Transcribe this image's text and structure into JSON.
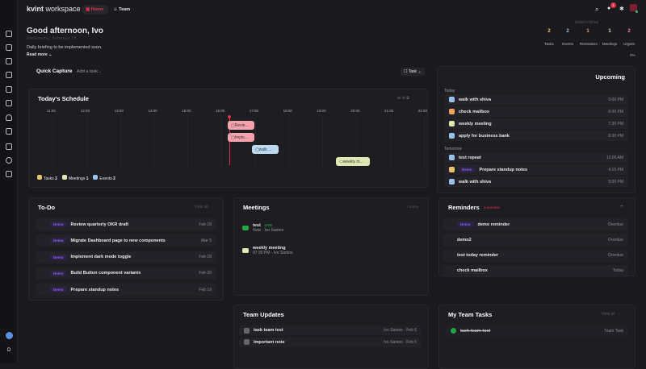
{
  "header": {
    "logo_bold": "kvint",
    "logo_rest": " workspace",
    "tabs": [
      {
        "label": "Home"
      },
      {
        "label": "Team"
      }
    ],
    "notif_count": "1"
  },
  "greeting": {
    "title": "Good afternoon, Ivo",
    "date": "Wednesday, February 18",
    "briefing": "Daily briefing to be implemented soon.",
    "read_more": "Read more"
  },
  "focus": {
    "label": "today's focus",
    "items": [
      {
        "value": "2",
        "label": "Tasks",
        "color": "#e7c46b"
      },
      {
        "value": "2",
        "label": "Events",
        "color": "#9cc3e6"
      },
      {
        "value": "1",
        "label": "Reminders",
        "color": "#e7a46b"
      },
      {
        "value": "1",
        "label": "Meetings",
        "color": "#d9e3a8"
      },
      {
        "value": "2",
        "label": "Urgent",
        "color": "#f08a9a"
      }
    ],
    "progress": "0%"
  },
  "quick_capture": {
    "title": "Quick Capture",
    "placeholder": "Add a task...",
    "type": "Task"
  },
  "schedule": {
    "title": "Today's Schedule",
    "hours": [
      "11:00",
      "12:00",
      "13:00",
      "14:00",
      "15:00",
      "16:00",
      "17:00",
      "18:00",
      "19:00",
      "20:00",
      "21:00",
      "22:00"
    ],
    "events": [
      {
        "label": "Revie...",
        "color": "#f4a3ae"
      },
      {
        "label": "Imple...",
        "color": "#f4a3ae"
      },
      {
        "label": "walk ...",
        "color": "#bcd9f0"
      },
      {
        "label": "weekly m...",
        "color": "#dfe8b5"
      }
    ],
    "legend": [
      {
        "label": "Tasks",
        "count": "2"
      },
      {
        "label": "Meetings",
        "count": "1"
      },
      {
        "label": "Events",
        "count": "2"
      }
    ]
  },
  "upcoming": {
    "title": "Upcoming",
    "groups": [
      {
        "label": "Today",
        "items": [
          {
            "title": "walk with shiva",
            "time": "5:00 PM",
            "color": "#9cc3e6"
          },
          {
            "title": "check mailbox",
            "time": "6:00 PM",
            "color": "#f0a35c"
          },
          {
            "title": "weekly meeting",
            "time": "7:30 PM",
            "color": "#dfe8b5"
          },
          {
            "title": "apply for business bank",
            "time": "6:00 PM",
            "color": "#9cc3e6"
          }
        ]
      },
      {
        "label": "Tomorrow",
        "items": [
          {
            "title": "test repeat",
            "time": "12:00 AM",
            "color": "#9cc3e6"
          },
          {
            "tag": "Demo",
            "title": "Prepare standup notes",
            "time": "4:15 PM",
            "color": "#e7c46b"
          },
          {
            "title": "walk with shiva",
            "time": "5:00 PM",
            "color": "#9cc3e6"
          }
        ]
      }
    ]
  },
  "todo": {
    "title": "To-Do",
    "view_all": "View all →",
    "items": [
      {
        "tag": "Demo",
        "title": "Review quarterly OKR draft",
        "date": "Feb 18"
      },
      {
        "tag": "Demo",
        "title": "Migrate Dashboard page to new components",
        "date": "Mar 5"
      },
      {
        "tag": "Demo",
        "title": "Implement dark mode toggle",
        "date": "Feb 18"
      },
      {
        "tag": "Demo",
        "title": "Build Button component variants",
        "date": "Feb 20"
      },
      {
        "tag": "Demo",
        "title": "Prepare standup notes",
        "date": "Feb 19"
      }
    ]
  },
  "meetings": {
    "title": "Meetings",
    "count": "2 today",
    "items": [
      {
        "title": "test",
        "badge": "LIVE",
        "sub": "Now · Ivo Santos",
        "color": "#22a447"
      },
      {
        "title": "weekly meeting",
        "sub": "07:30 PM · Ivo Santos",
        "color": "#dfe8b5"
      }
    ]
  },
  "reminders": {
    "title": "Reminders",
    "overdue": "3 overdue",
    "add": "+",
    "items": [
      {
        "tag": "Demo",
        "title": "demo reminder",
        "status": "Overdue"
      },
      {
        "title": "demo2",
        "status": "Overdue"
      },
      {
        "title": "test today reminder",
        "status": "Overdue"
      },
      {
        "title": "check mailbox",
        "status": "Today"
      }
    ]
  },
  "team_updates": {
    "title": "Team Updates",
    "items": [
      {
        "title": "task team test",
        "meta": "Ivo Santos · Feb 6"
      },
      {
        "title": "important note",
        "meta": "Ivo Santos · Feb 6"
      }
    ]
  },
  "team_tasks": {
    "title": "My Team Tasks",
    "view_all": "View all →",
    "items": [
      {
        "title": "task-team-test",
        "meta": "Team Task"
      }
    ]
  },
  "sidebar": {
    "user_initial": "D"
  }
}
